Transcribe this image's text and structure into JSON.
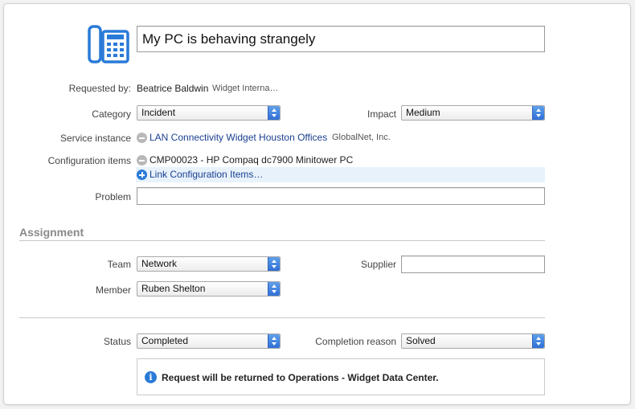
{
  "header": {
    "title_value": "My PC is behaving strangely"
  },
  "requested_by": {
    "label": "Requested by:",
    "name": "Beatrice Baldwin",
    "org": "Widget Interna…"
  },
  "category": {
    "label": "Category",
    "value": "Incident"
  },
  "impact": {
    "label": "Impact",
    "value": "Medium"
  },
  "service_instance": {
    "label": "Service instance",
    "value": "LAN Connectivity Widget Houston Offices",
    "org": "GlobalNet, Inc."
  },
  "configuration_items": {
    "label": "Configuration items",
    "items": [
      "CMP00023 - HP Compaq dc7900 Minitower PC"
    ],
    "link_label": "Link Configuration Items…"
  },
  "problem": {
    "label": "Problem",
    "value": ""
  },
  "assignment": {
    "section_title": "Assignment",
    "team": {
      "label": "Team",
      "value": "Network"
    },
    "supplier": {
      "label": "Supplier",
      "value": ""
    },
    "member": {
      "label": "Member",
      "value": "Ruben Shelton"
    }
  },
  "status": {
    "label": "Status",
    "value": "Completed"
  },
  "completion_reason": {
    "label": "Completion reason",
    "value": "Solved"
  },
  "info_message": "Request will be returned to Operations - Widget Data Center.",
  "colors": {
    "accent": "#2a7ad8",
    "link": "#1a3f8f",
    "section_title": "#8a8a8a"
  },
  "icons": {
    "header": "phone-icon",
    "remove": "minus-circle-icon",
    "add": "plus-circle-icon",
    "info": "info-icon"
  }
}
